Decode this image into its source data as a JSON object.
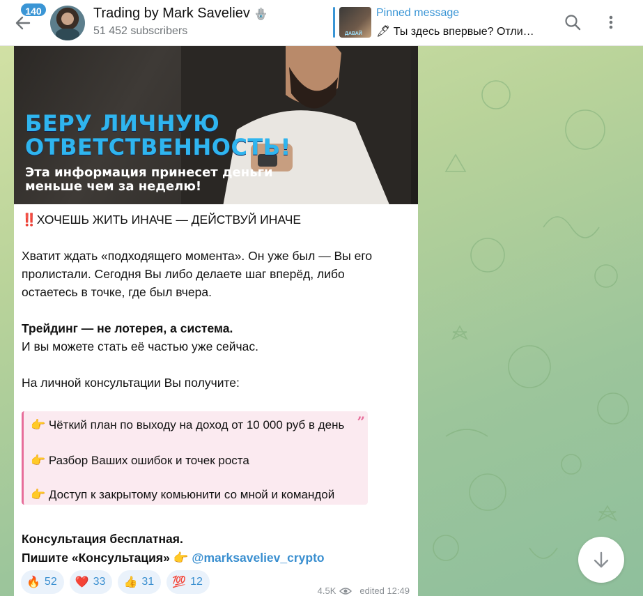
{
  "header": {
    "unread_count": "140",
    "channel_title": "Trading by Mark Saveliev",
    "title_emoji": "🪬",
    "subscribers": "51 452 subscribers",
    "pinned_label": "Pinned message",
    "pinned_text": "🖋 Ты здесь впервые? Отли…",
    "pinned_thumb_label": "ДАВАЙ"
  },
  "banner": {
    "headline_line1": "БЕРУ ЛИЧНУЮ",
    "headline_line2": "ОТВЕТСТВЕННОСТЬ!",
    "subline_line1": "Эта информация принесет деньги",
    "subline_line2": "меньше чем за неделю!"
  },
  "post": {
    "heading": "‼️ХОЧЕШЬ ЖИТЬ ИНАЧЕ — ДЕЙСТВУЙ ИНАЧЕ",
    "para1": "Хватит ждать «подходящего момента». Он уже был — Вы его пролистали. Сегодня Вы либо делаете шаг вперёд, либо остаетесь в точке, где был вчера.",
    "para2_bold": "Трейдинг — не лотерея, а система.",
    "para2_rest": "И вы можете стать её частью уже сейчас.",
    "para3": "На личной консультации Вы  получите:",
    "quote_items": [
      "👉 Чёткий план по выходу на доход от 10 000 руб в день",
      "👉 Разбор Ваших ошибок и точек роста",
      "👉 Доступ к закрытому комьюнити со мной и командой"
    ],
    "cta_line1": "Консультация бесплатная.",
    "cta_line2": "Пишите «Консультация» 👉 ",
    "cta_link": "@marksaveliev_crypto"
  },
  "reactions": [
    {
      "emoji": "🔥",
      "count": "52"
    },
    {
      "emoji": "❤️",
      "count": "33"
    },
    {
      "emoji": "👍",
      "count": "31"
    },
    {
      "emoji": "💯",
      "count": "12"
    }
  ],
  "meta": {
    "views": "4.5K",
    "edited": "edited 12:49"
  },
  "icons": {
    "back": "arrow-left-icon",
    "search": "search-icon",
    "more": "more-vertical-icon",
    "views": "eye-icon",
    "scroll": "arrow-down-icon"
  },
  "colors": {
    "accent": "#3a95d5",
    "quote_border": "#e76d9a",
    "quote_bg": "#fbeaf0",
    "banner_headline": "#2fb5ef"
  }
}
